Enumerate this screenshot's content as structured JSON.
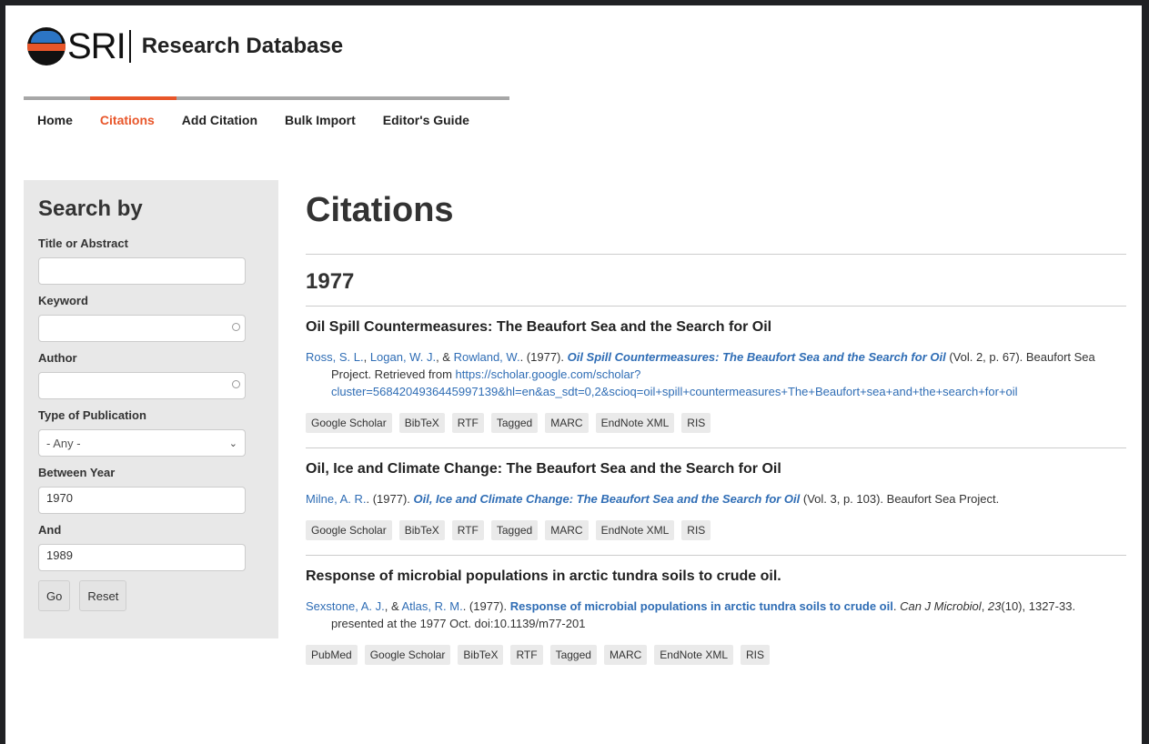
{
  "header": {
    "logo_text": "SRI",
    "site_name": "Research Database"
  },
  "nav": {
    "items": [
      "Home",
      "Citations",
      "Add Citation",
      "Bulk Import",
      "Editor's Guide"
    ],
    "active": "Citations"
  },
  "sidebar": {
    "title": "Search by",
    "title_abstract_label": "Title or Abstract",
    "title_abstract_value": "",
    "keyword_label": "Keyword",
    "keyword_value": "",
    "author_label": "Author",
    "author_value": "",
    "type_label": "Type of Publication",
    "type_value": "- Any -",
    "between_label": "Between Year",
    "between_value": "1970",
    "and_label": "And",
    "and_value": "1989",
    "go_label": "Go",
    "reset_label": "Reset"
  },
  "main": {
    "title": "Citations",
    "year": "1977",
    "citations": [
      {
        "title": "Oil Spill Countermeasures: The Beaufort Sea and the Search for Oil",
        "authors": [
          "Ross, S. L.",
          "Logan, W. J.",
          "Rowland, W."
        ],
        "sep1": ", ",
        "sep2": ", & ",
        "year_text": ". (1977). ",
        "work_title": "Oil Spill Countermeasures: The Beaufort Sea and the Search for Oil",
        "details": " (Vol. 2, p. 67). Beaufort Sea Project. Retrieved from ",
        "url": "https://scholar.google.com/scholar?cluster=5684204936445997139&hl=en&as_sdt=0,2&scioq=oil+spill+countermeasures+The+Beaufort+sea+and+the+search+for+oil",
        "tags": [
          "Google Scholar",
          "BibTeX",
          "RTF",
          "Tagged",
          "MARC",
          "EndNote XML",
          "RIS"
        ]
      },
      {
        "title": "Oil, Ice and Climate Change: The Beaufort Sea and the Search for Oil",
        "authors": [
          "Milne, A. R."
        ],
        "year_text": ". (1977). ",
        "work_title": "Oil, Ice and Climate Change: The Beaufort Sea and the Search for Oil",
        "details": " (Vol. 3, p. 103). Beaufort Sea Project.",
        "tags": [
          "Google Scholar",
          "BibTeX",
          "RTF",
          "Tagged",
          "MARC",
          "EndNote XML",
          "RIS"
        ]
      },
      {
        "title": "Response of microbial populations in arctic tundra soils to crude oil.",
        "authors": [
          "Sexstone, A. J.",
          "Atlas, R. M."
        ],
        "sep1": ", & ",
        "year_text": ". (1977). ",
        "work_title": "Response of microbial populations in arctic tundra soils to crude oil",
        "journal": "Can J Microbiol",
        "volume": "23",
        "details": "(10), 1327-33. presented at the 1977 Oct. doi:10.1139/m77-201",
        "tags": [
          "PubMed",
          "Google Scholar",
          "BibTeX",
          "RTF",
          "Tagged",
          "MARC",
          "EndNote XML",
          "RIS"
        ]
      }
    ]
  },
  "colors": {
    "accent": "#e8562a",
    "link": "#2f6db5"
  }
}
